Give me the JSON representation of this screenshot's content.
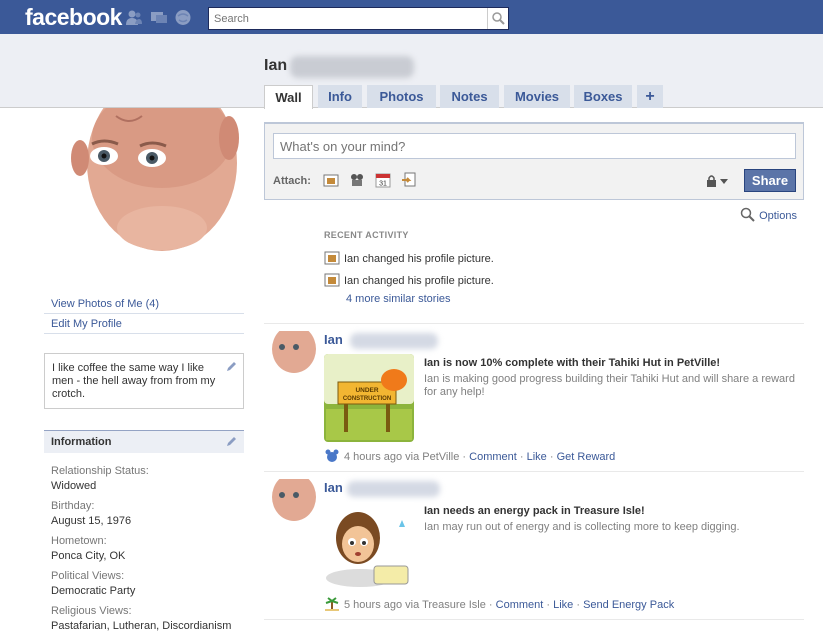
{
  "topbar": {
    "logo": "facebook",
    "search_placeholder": "Search",
    "icons": [
      "friends-icon",
      "messages-icon",
      "notifications-icon",
      "search-icon"
    ]
  },
  "profile": {
    "first_name": "Ian",
    "tabs": [
      {
        "label": "Wall",
        "active": true
      },
      {
        "label": "Info"
      },
      {
        "label": "Photos"
      },
      {
        "label": "Notes"
      },
      {
        "label": "Movies"
      },
      {
        "label": "Boxes"
      },
      {
        "label": "+"
      }
    ]
  },
  "left": {
    "links": [
      "View Photos of Me (4)",
      "Edit My Profile"
    ],
    "bio": "I like coffee the same way I like men - the hell away from from my crotch.",
    "info_title": "Information",
    "info": [
      {
        "label": "Relationship Status:",
        "value": "Widowed"
      },
      {
        "label": "Birthday:",
        "value": "August 15, 1976"
      },
      {
        "label": "Hometown:",
        "value": "Ponca City, OK"
      },
      {
        "label": "Political Views:",
        "value": "Democratic Party"
      },
      {
        "label": "Religious Views:",
        "value": "Pastafarian, Lutheran, Discordianism"
      }
    ]
  },
  "composer": {
    "placeholder": "What's on your mind?",
    "attach_label": "Attach:",
    "share_label": "Share",
    "options_label": "Options"
  },
  "recent": {
    "title": "RECENT ACTIVITY",
    "items": [
      "Ian changed his profile picture.",
      "Ian changed his profile picture."
    ],
    "more": "4 more similar stories"
  },
  "stories": [
    {
      "name": "Ian",
      "headline": "Ian is now 10% complete with their Tahiki Hut in PetVille!",
      "sub": "Ian is making good progress building their Tahiki Hut and will share a reward for any help!",
      "image_text": "UNDER CONSTRUCTION",
      "time": "4 hours ago via PetVille",
      "actions": [
        "Comment",
        "Like",
        "Get Reward"
      ]
    },
    {
      "name": "Ian",
      "headline": "Ian needs an energy pack in Treasure Isle!",
      "sub": "Ian may run out of energy and is collecting more to keep digging.",
      "time": "5 hours ago via Treasure Isle",
      "actions": [
        "Comment",
        "Like",
        "Send Energy Pack"
      ]
    }
  ],
  "colors": {
    "brand": "#3b5998",
    "tab_bg": "#d8dfea",
    "share_button": "#5b74a8"
  }
}
